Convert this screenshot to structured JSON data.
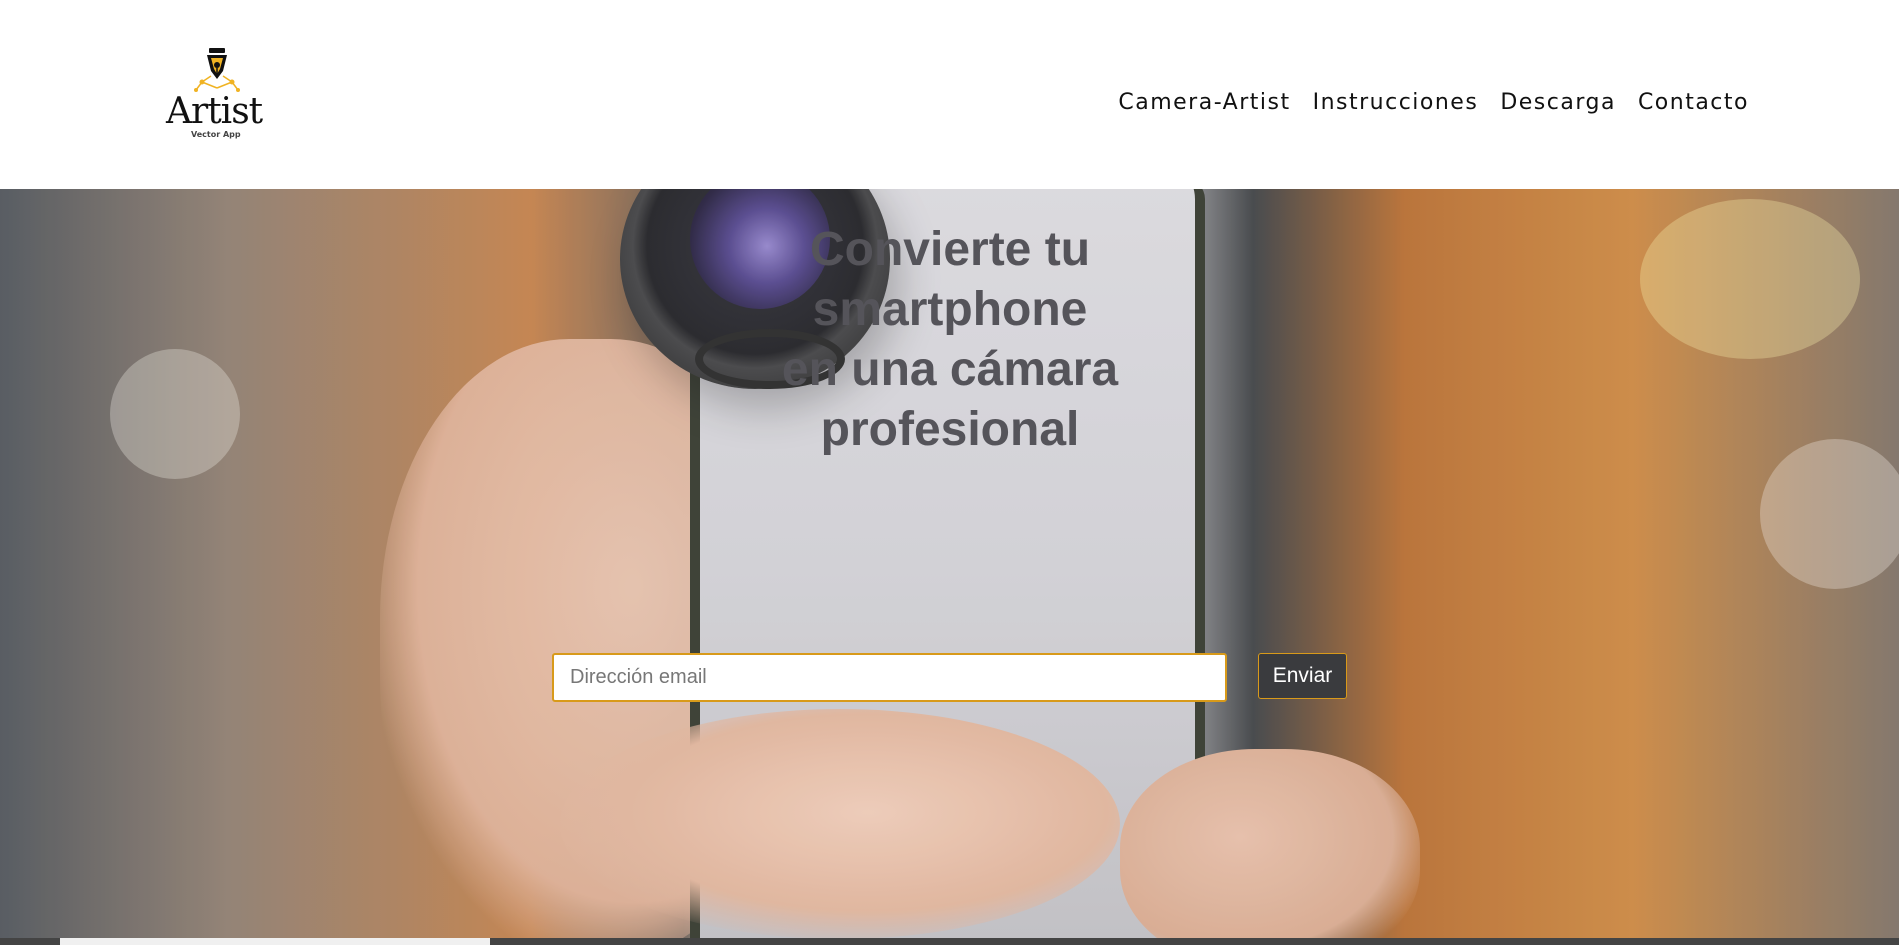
{
  "header": {
    "logo": {
      "wordmark": "Artist",
      "subtitle": "Vector App",
      "icon": "pen-nib-icon",
      "accent_color": "#f0b323"
    },
    "nav": [
      {
        "label": "Camera-Artist"
      },
      {
        "label": "Instrucciones"
      },
      {
        "label": "Descarga"
      },
      {
        "label": "Contacto"
      }
    ]
  },
  "hero": {
    "headline_lines": [
      "Convierte tu",
      "smartphone",
      "en una cámara",
      "profesional"
    ],
    "email": {
      "placeholder": "Dirección email",
      "value": ""
    },
    "submit_label": "Enviar",
    "accent_color": "#d89a1a"
  }
}
